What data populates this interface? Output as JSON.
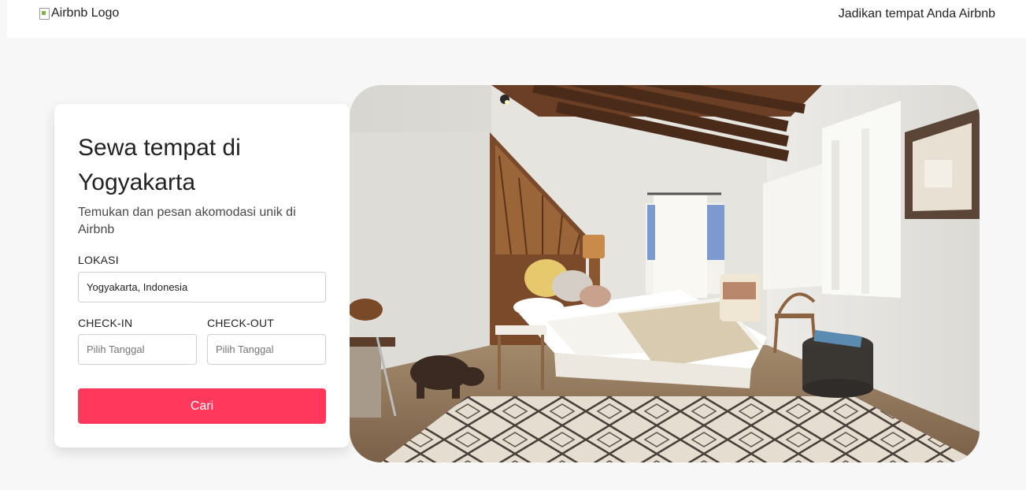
{
  "header": {
    "logo_alt": "Airbnb Logo",
    "host_link": "Jadikan tempat Anda Airbnb"
  },
  "search_card": {
    "title": "Sewa tempat di Yogyakarta",
    "subtitle": "Temukan dan pesan akomodasi unik di Airbnb",
    "location_label": "LOKASI",
    "location_value": "Yogyakarta, Indonesia",
    "checkin_label": "CHECK-IN",
    "checkin_placeholder": "Pilih Tanggal",
    "checkout_label": "CHECK-OUT",
    "checkout_placeholder": "Pilih Tanggal",
    "search_button": "Cari"
  },
  "colors": {
    "brand": "#ff385c",
    "background": "#f7f7f7"
  }
}
